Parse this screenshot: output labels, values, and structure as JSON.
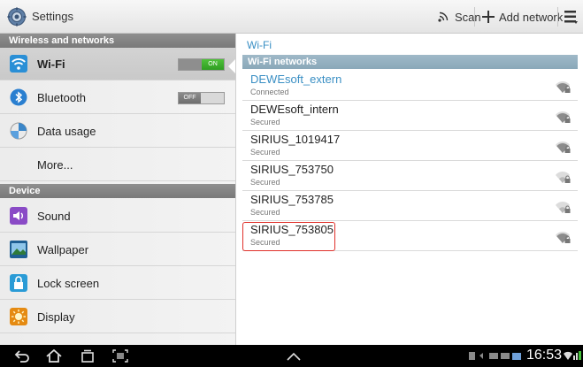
{
  "titlebar": {
    "title": "Settings",
    "scan_label": "Scan",
    "add_network_label": "Add network"
  },
  "left": {
    "sections": {
      "wireless": "Wireless and networks",
      "device": "Device"
    },
    "items": {
      "wifi": {
        "label": "Wi-Fi",
        "toggle": "ON"
      },
      "bluetooth": {
        "label": "Bluetooth",
        "toggle": "OFF"
      },
      "data_usage": {
        "label": "Data usage"
      },
      "more": {
        "label": "More..."
      },
      "sound": {
        "label": "Sound"
      },
      "wallpaper": {
        "label": "Wallpaper"
      },
      "lock_screen": {
        "label": "Lock screen"
      },
      "display": {
        "label": "Display"
      }
    }
  },
  "right": {
    "title": "Wi-Fi",
    "networks_header": "Wi-Fi networks",
    "networks": [
      {
        "name": "DEWEsoft_extern",
        "status": "Connected",
        "signal": "strong"
      },
      {
        "name": "DEWEsoft_intern",
        "status": "Secured",
        "signal": "strong"
      },
      {
        "name": "SIRIUS_1019417",
        "status": "Secured",
        "signal": "strong"
      },
      {
        "name": "SIRIUS_753750",
        "status": "Secured",
        "signal": "weak"
      },
      {
        "name": "SIRIUS_753785",
        "status": "Secured",
        "signal": "weak"
      },
      {
        "name": "SIRIUS_753805",
        "status": "Secured",
        "signal": "strong"
      }
    ]
  },
  "statusbar": {
    "time": "16:53"
  },
  "colors": {
    "accent_blue": "#3a8fc4",
    "toggle_on": "#3fb02e",
    "highlight_red": "#e0302a"
  }
}
